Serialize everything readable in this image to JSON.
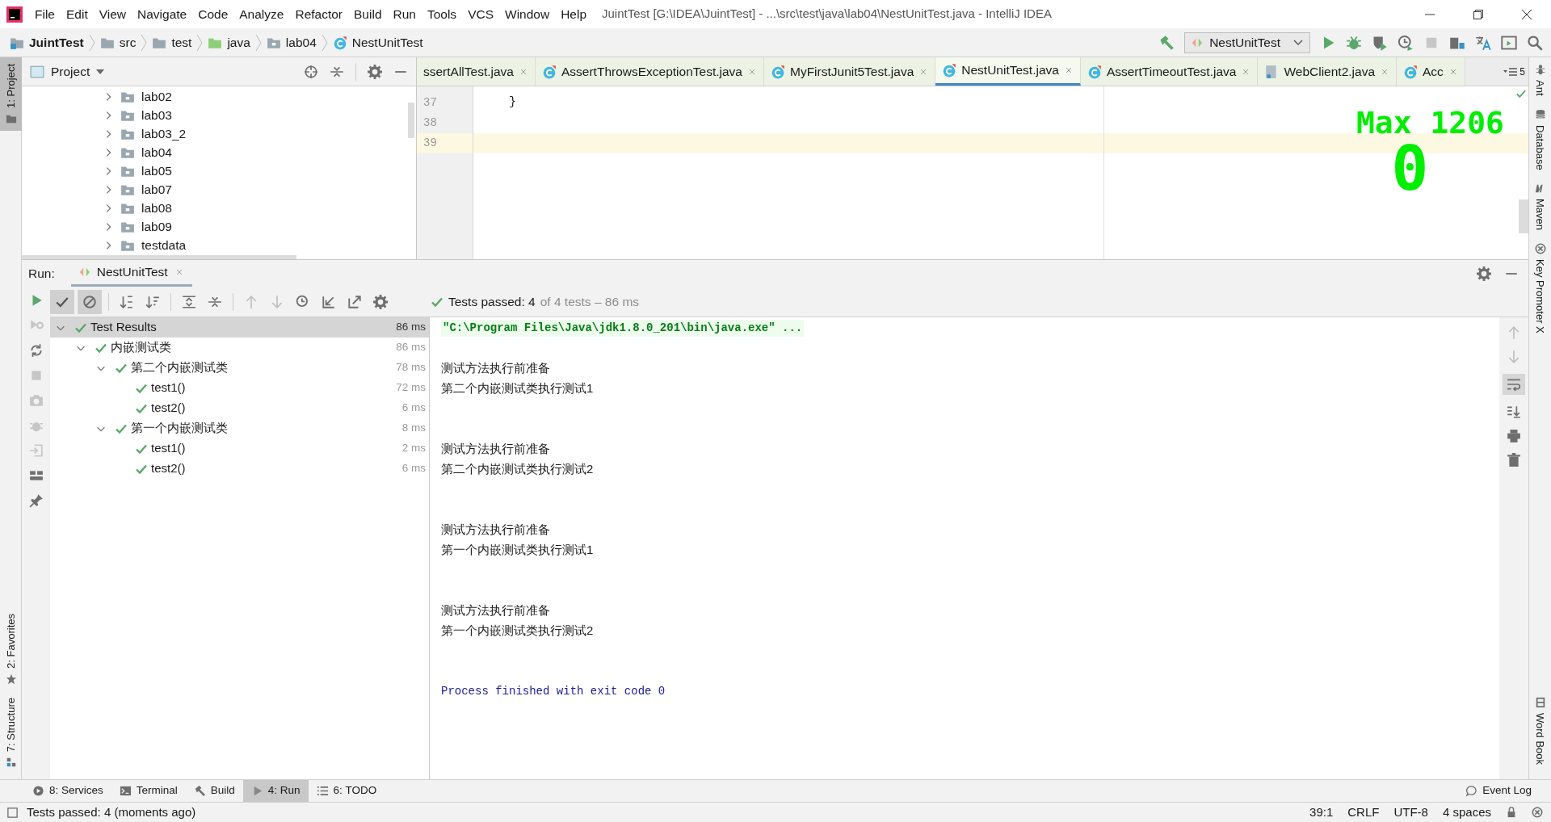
{
  "menu": [
    "File",
    "Edit",
    "View",
    "Navigate",
    "Code",
    "Analyze",
    "Refactor",
    "Build",
    "Run",
    "Tools",
    "VCS",
    "Window",
    "Help"
  ],
  "window": {
    "title": "JuintTest [G:\\IDEA\\JuintTest] - ...\\src\\test\\java\\lab04\\NestUnitTest.java - IntelliJ IDEA"
  },
  "breadcrumbs": [
    {
      "label": "JuintTest",
      "kind": "project"
    },
    {
      "label": "src",
      "kind": "folder"
    },
    {
      "label": "test",
      "kind": "folder"
    },
    {
      "label": "java",
      "kind": "source"
    },
    {
      "label": "lab04",
      "kind": "package"
    },
    {
      "label": "NestUnitTest",
      "kind": "class"
    }
  ],
  "run_config": "NestUnitTest",
  "left_stripe": {
    "top": [
      {
        "label": "1: Project",
        "selected": true
      }
    ],
    "bottom": [
      {
        "label": "2: Favorites",
        "selected": false
      },
      {
        "label": "7: Structure",
        "selected": false
      }
    ]
  },
  "project": {
    "title": "Project",
    "items": [
      {
        "label": "lab02",
        "expanded": false
      },
      {
        "label": "lab03",
        "expanded": false
      },
      {
        "label": "lab03_2",
        "expanded": false
      },
      {
        "label": "lab04",
        "expanded": false
      },
      {
        "label": "lab05",
        "expanded": false
      },
      {
        "label": "lab07",
        "expanded": false
      },
      {
        "label": "lab08",
        "expanded": false
      },
      {
        "label": "lab09",
        "expanded": false
      },
      {
        "label": "testdata",
        "expanded": false
      }
    ]
  },
  "editor_tabs": [
    {
      "label": "ssertAllTest.java",
      "selected": false
    },
    {
      "label": "AssertThrowsExceptionTest.java",
      "kind": "class",
      "selected": false
    },
    {
      "label": "MyFirstJunit5Test.java",
      "kind": "class",
      "selected": false
    },
    {
      "label": "NestUnitTest.java",
      "kind": "class",
      "selected": true
    },
    {
      "label": "AssertTimeoutTest.java",
      "kind": "class",
      "selected": false
    },
    {
      "label": "WebClient2.java",
      "kind": "file",
      "selected": false
    },
    {
      "label": "Acc",
      "kind": "class",
      "selected": false
    }
  ],
  "tab_overflow": "5",
  "editor": {
    "lines": [
      {
        "number": "37",
        "code": "}",
        "current": false
      },
      {
        "number": "38",
        "current": false
      },
      {
        "number": "39",
        "current": true
      }
    ],
    "overlay": {
      "label": "Max 1206",
      "count": "0"
    }
  },
  "run": {
    "label": "Run:",
    "tab": "NestUnitTest",
    "status": "Tests passed: 4",
    "status_detail": "of 4 tests – 86 ms",
    "results": [
      {
        "label": "Test Results",
        "time": "86 ms",
        "selected": true,
        "expanded": true,
        "children": [
          {
            "label": "内嵌测试类",
            "time": "86 ms",
            "selected": false,
            "expanded": true,
            "children": [
              {
                "label": "第二个内嵌测试类",
                "time": "78 ms",
                "selected": false,
                "expanded": true,
                "children": [
                  {
                    "label": "test1()",
                    "time": "72 ms",
                    "selected": false
                  },
                  {
                    "label": "test2()",
                    "time": "6 ms",
                    "selected": false
                  }
                ]
              },
              {
                "label": "第一个内嵌测试类",
                "time": "8 ms",
                "selected": false,
                "expanded": true,
                "children": [
                  {
                    "label": "test1()",
                    "time": "2 ms",
                    "selected": false
                  },
                  {
                    "label": "test2()",
                    "time": "6 ms",
                    "selected": false
                  }
                ]
              }
            ]
          }
        ]
      }
    ],
    "console": [
      {
        "kind": "command",
        "text": "\"C:\\Program Files\\Java\\jdk1.8.0_201\\bin\\java.exe\" ..."
      },
      {
        "kind": "blank"
      },
      {
        "kind": "output",
        "text": "测试方法执行前准备"
      },
      {
        "kind": "output",
        "text": "第二个内嵌测试类执行测试1"
      },
      {
        "kind": "blank"
      },
      {
        "kind": "blank"
      },
      {
        "kind": "output",
        "text": "测试方法执行前准备"
      },
      {
        "kind": "output",
        "text": "第二个内嵌测试类执行测试2"
      },
      {
        "kind": "blank"
      },
      {
        "kind": "blank"
      },
      {
        "kind": "output",
        "text": "测试方法执行前准备"
      },
      {
        "kind": "output",
        "text": "第一个内嵌测试类执行测试1"
      },
      {
        "kind": "blank"
      },
      {
        "kind": "blank"
      },
      {
        "kind": "output",
        "text": "测试方法执行前准备"
      },
      {
        "kind": "output",
        "text": "第一个内嵌测试类执行测试2"
      },
      {
        "kind": "blank"
      },
      {
        "kind": "blank"
      },
      {
        "kind": "exit",
        "text": "Process finished with exit code 0"
      }
    ]
  },
  "right_stripe": [
    "Ant",
    "Database",
    "Maven",
    "Key Promoter X"
  ],
  "right_stripe_bottom": [
    "Word Book"
  ],
  "bottom_tabs": [
    {
      "label": "8: Services",
      "kind": "services",
      "selected": false
    },
    {
      "label": "Terminal",
      "kind": "terminal",
      "selected": false
    },
    {
      "label": "Build",
      "kind": "build",
      "selected": false
    },
    {
      "label": "4: Run",
      "kind": "run",
      "selected": true
    },
    {
      "label": "6: TODO",
      "kind": "todo",
      "selected": false
    }
  ],
  "event_log": "Event Log",
  "status_bar": {
    "message": "Tests passed: 4 (moments ago)",
    "position": "39:1",
    "line_separator": "CRLF",
    "encoding": "UTF-8",
    "indent": "4 spaces"
  }
}
